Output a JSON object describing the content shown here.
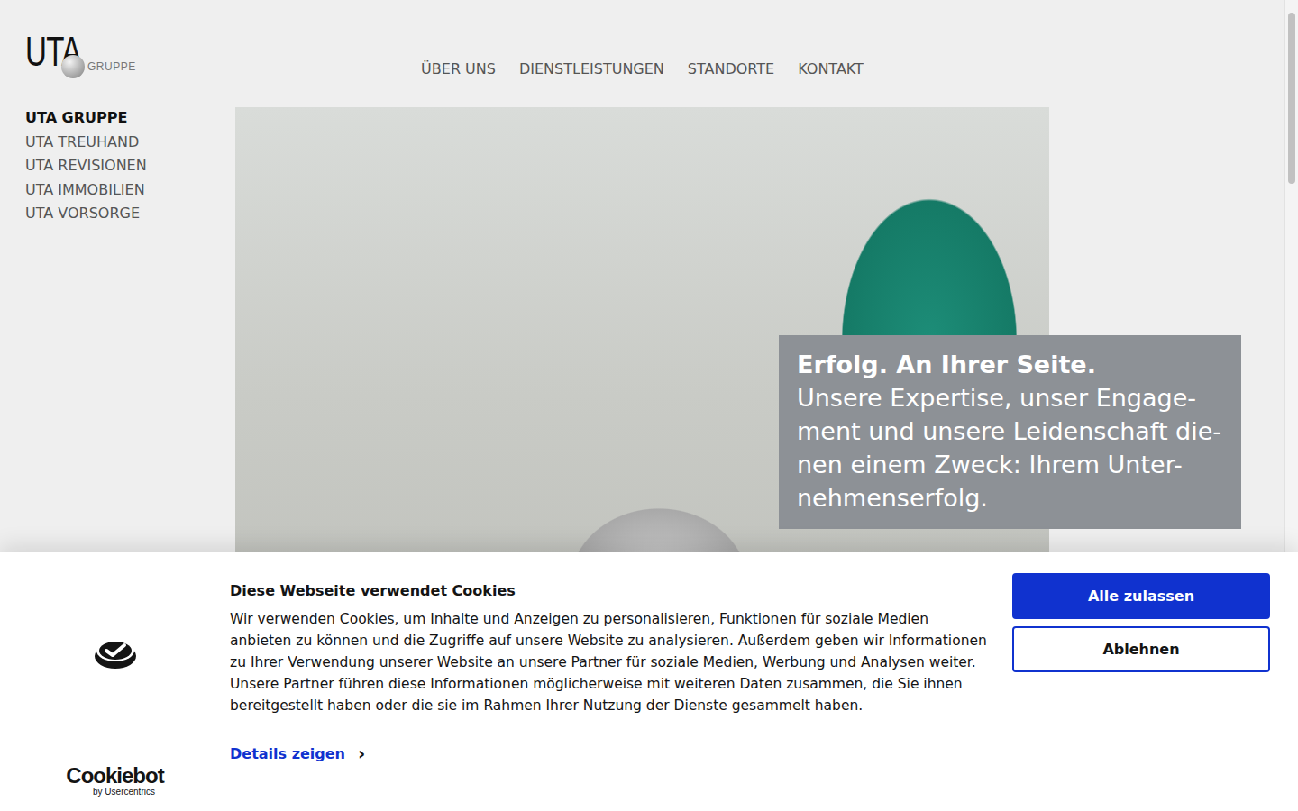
{
  "logo": {
    "text": "UTA",
    "subtext": "GRUPPE"
  },
  "nav": [
    "ÜBER UNS",
    "DIENSTLEISTUNGEN",
    "STANDORTE",
    "KONTAKT"
  ],
  "sidebar": {
    "items": [
      {
        "label": "UTA GRUPPE",
        "selected": true
      },
      {
        "label": "UTA TREUHAND",
        "selected": false
      },
      {
        "label": "UTA REVISIONEN",
        "selected": false
      },
      {
        "label": "UTA IMMOBILIEN",
        "selected": false
      },
      {
        "label": "UTA VORSORGE",
        "selected": false
      }
    ]
  },
  "hero": {
    "title": "Erfolg. An Ihrer Seite.",
    "lines": [
      "Unsere Expertise, unser Engage-",
      "ment und unsere Leidenschaft die-",
      "nen einem Zweck: Ihrem Unter-",
      "nehmenserfolg."
    ]
  },
  "cookie_banner": {
    "title": "Diese Webseite verwendet Cookies",
    "body": "Wir verwenden Cookies, um Inhalte und Anzeigen zu personalisieren, Funktionen für soziale Medien anbieten zu können und die Zugriffe auf unsere Website zu analysieren. Außerdem geben wir Informationen zu Ihrer Verwendung unserer Website an unsere Partner für soziale Medien, Werbung und Analysen weiter. Unsere Partner führen diese Informationen möglicherweise mit weiteren Daten zusammen, die Sie ihnen bereitgestellt haben oder die sie im Rahmen Ihrer Nutzung der Dienste gesammelt haben.",
    "details_link": "Details zeigen",
    "details_icon": "›",
    "brand": "Cookiebot",
    "brand_sub": "by Usercentrics",
    "buttons": [
      {
        "label": "Alle zulassen",
        "kind": "primary"
      },
      {
        "label": "Ablehnen",
        "kind": "secondary"
      }
    ]
  }
}
